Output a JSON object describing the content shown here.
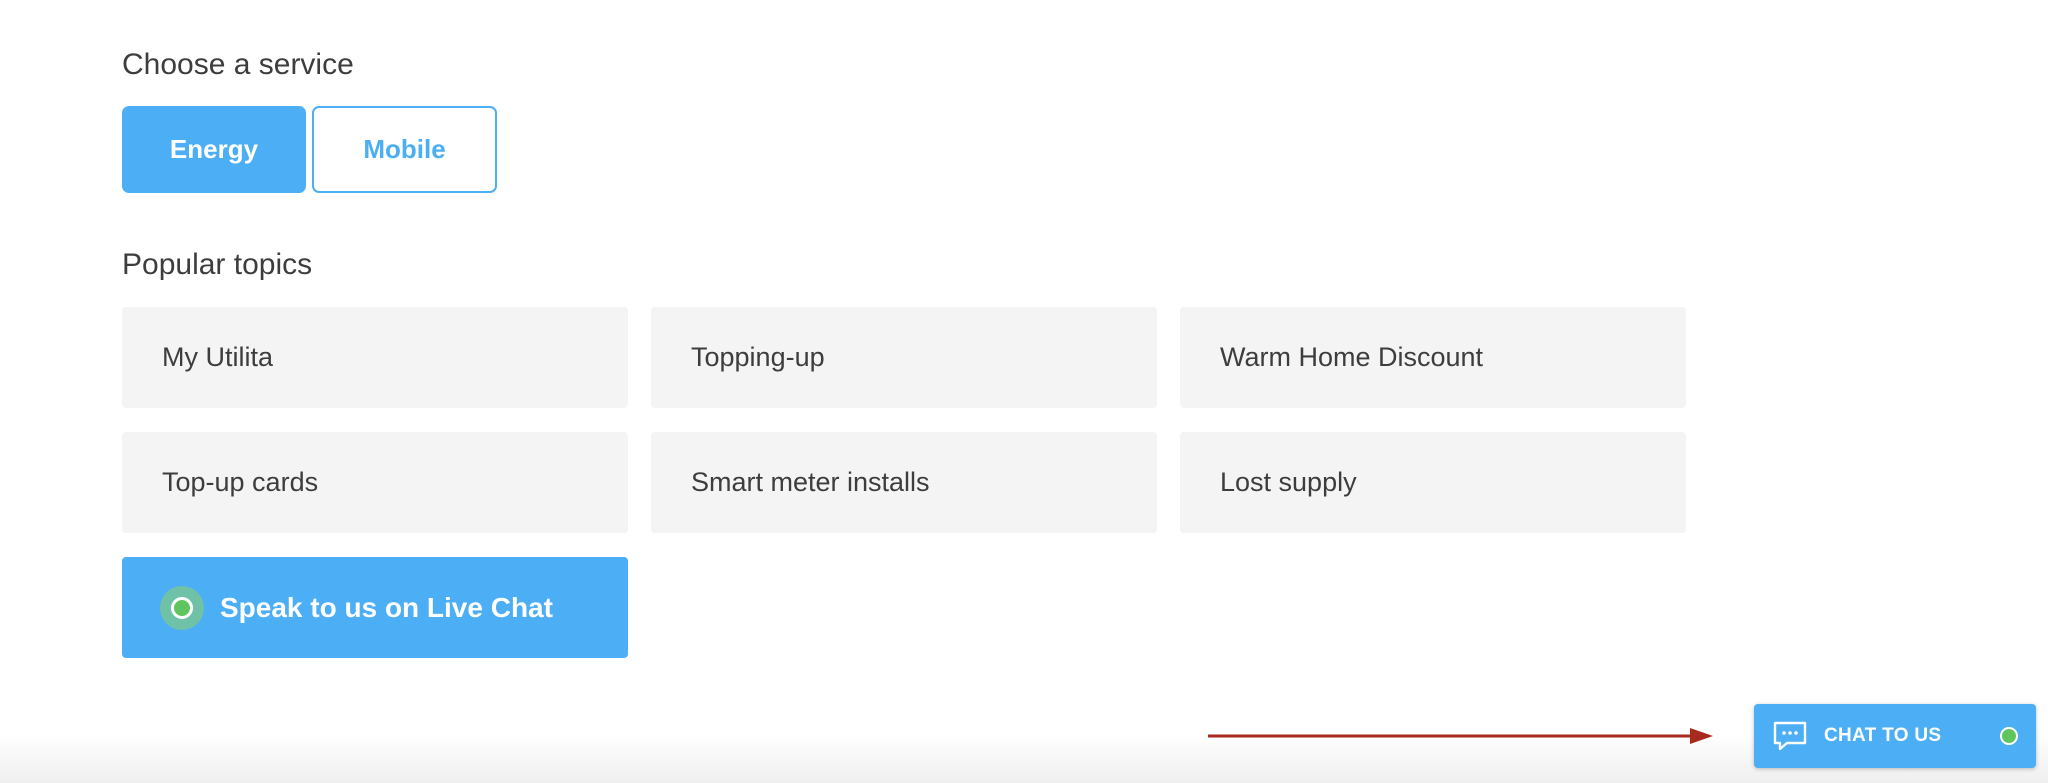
{
  "service_section": {
    "title": "Choose a service",
    "options": [
      {
        "label": "Energy",
        "selected": true
      },
      {
        "label": "Mobile",
        "selected": false
      }
    ]
  },
  "topics_section": {
    "title": "Popular topics",
    "topics": [
      {
        "label": "My Utilita"
      },
      {
        "label": "Topping-up"
      },
      {
        "label": "Warm Home Discount"
      },
      {
        "label": "Top-up cards"
      },
      {
        "label": "Smart meter installs"
      },
      {
        "label": "Lost supply"
      }
    ]
  },
  "live_chat_button": {
    "label": "Speak to us on Live Chat",
    "status_color": "#5fc55f"
  },
  "chat_widget": {
    "label": "CHAT TO US",
    "icon": "chat-bubble-icon",
    "status_color": "#5fc55f"
  },
  "annotation": {
    "arrow_color": "#a8291d"
  },
  "theme": {
    "accent": "#4caef5",
    "tile_background": "#f4f4f4",
    "text": "#3d3d3d"
  }
}
